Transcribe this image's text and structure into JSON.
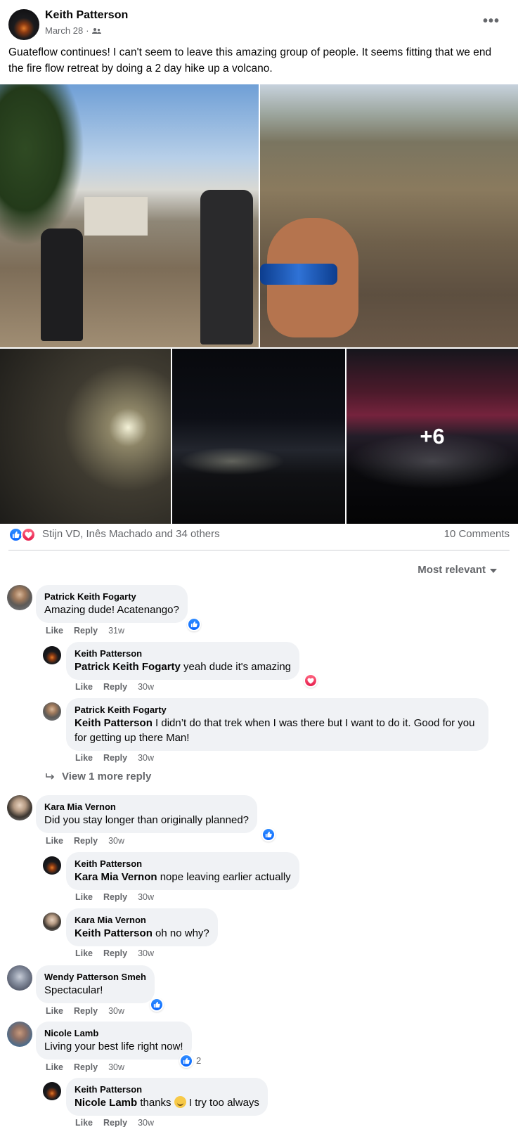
{
  "post": {
    "author": "Keith Patterson",
    "date": "March 28",
    "audience_separator": "·",
    "more_label": "•••",
    "text": "Guateflow continues! I can't seem to leave this amazing group of people. It seems fitting that we end the fire flow retreat by doing a 2 day hike up a volcano.",
    "more_photos": "+6"
  },
  "reactions": {
    "names": "Stijn VD, Inês Machado and 34 others",
    "comments_count": "10 Comments"
  },
  "sort_label": "Most relevant",
  "comments": [
    {
      "name": "Patrick Keith Fogarty",
      "text": "Amazing dude! Acatenango?",
      "like": "Like",
      "reply": "Reply",
      "time": "31w"
    },
    {
      "name": "Keith Patterson",
      "mention": "Patrick Keith Fogarty",
      "text": " yeah dude it's amazing",
      "like": "Like",
      "reply": "Reply",
      "time": "30w"
    },
    {
      "name": "Patrick Keith Fogarty",
      "mention": "Keith Patterson",
      "text": " I didn’t do that trek when I was there but I want to do it. Good for you for getting up there Man!",
      "like": "Like",
      "reply": "Reply",
      "time": "30w"
    },
    {
      "name": "Kara Mia Vernon",
      "text": "Did you stay longer than originally planned?",
      "like": "Like",
      "reply": "Reply",
      "time": "30w"
    },
    {
      "name": "Keith Patterson",
      "mention": "Kara Mia Vernon",
      "text": " nope leaving earlier actually",
      "like": "Like",
      "reply": "Reply",
      "time": "30w"
    },
    {
      "name": "Kara Mia Vernon",
      "mention": "Keith Patterson",
      "text": " oh no why?",
      "like": "Like",
      "reply": "Reply",
      "time": "30w"
    },
    {
      "name": "Wendy Patterson Smeh",
      "text": "Spectacular!",
      "like": "Like",
      "reply": "Reply",
      "time": "30w"
    },
    {
      "name": "Nicole Lamb",
      "text": "Living your best life right now!",
      "like": "Like",
      "reply": "Reply",
      "time": "30w",
      "react_count": "2"
    },
    {
      "name": "Keith Patterson",
      "mention": "Nicole Lamb",
      "text_before": " thanks ",
      "text_after": " I try too always",
      "like": "Like",
      "reply": "Reply",
      "time": "30w"
    }
  ],
  "view_more": "View 1 more reply",
  "colors": {
    "like_blue": "#0866ff",
    "love_red": "#e61e4d",
    "bubble_bg": "#f0f2f5",
    "meta_gray": "#65676b"
  }
}
